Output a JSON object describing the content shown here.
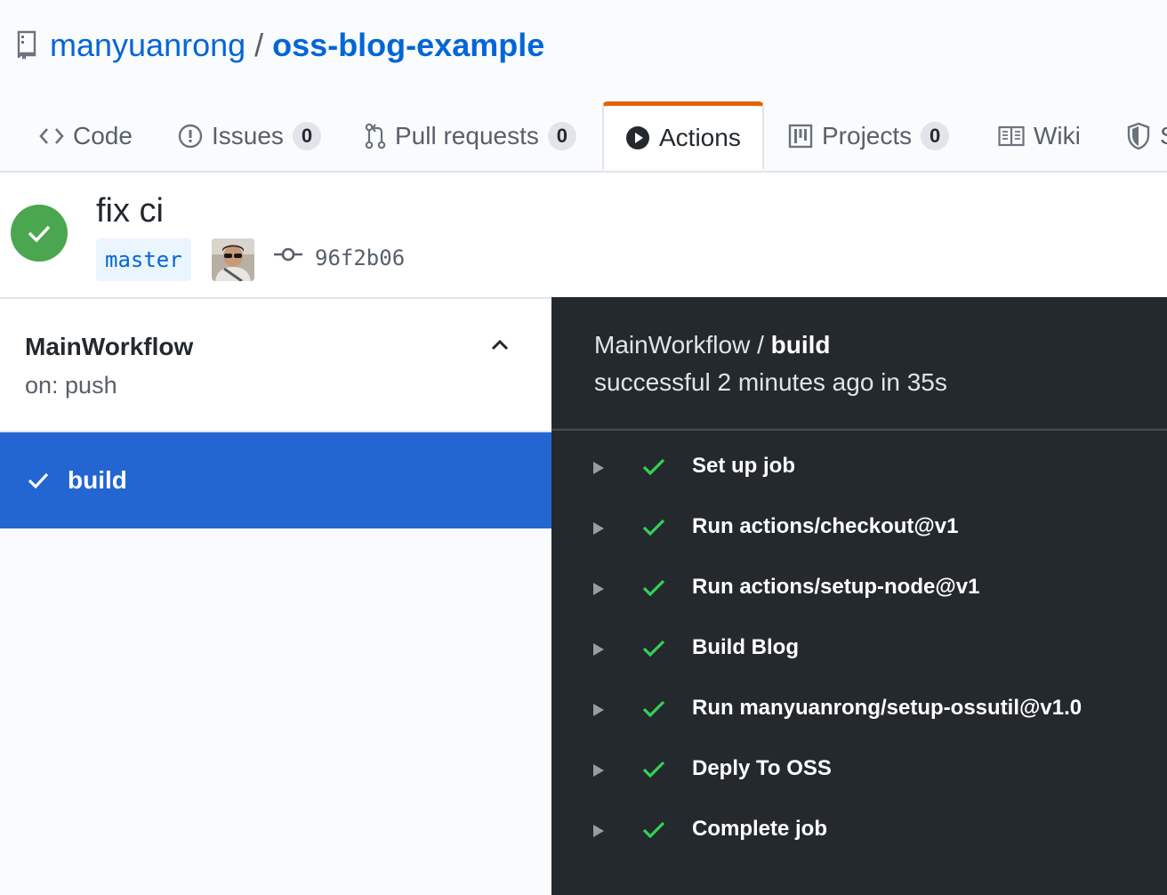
{
  "repo": {
    "owner": "manyuanrong",
    "separator": "/",
    "name": "oss-blog-example"
  },
  "tabs": [
    {
      "label": "Code",
      "icon": "code-icon"
    },
    {
      "label": "Issues",
      "count": "0",
      "icon": "issue-icon"
    },
    {
      "label": "Pull requests",
      "count": "0",
      "icon": "pull-request-icon"
    },
    {
      "label": "Actions",
      "icon": "play-icon",
      "selected": true
    },
    {
      "label": "Projects",
      "count": "0",
      "icon": "project-icon"
    },
    {
      "label": "Wiki",
      "icon": "book-icon"
    },
    {
      "label": "S",
      "icon": "shield-icon"
    }
  ],
  "run": {
    "title": "fix ci",
    "status": "success",
    "branch": "master",
    "commit_sha": "96f2b06"
  },
  "workflow": {
    "name": "MainWorkflow",
    "trigger": "on: push"
  },
  "jobs": [
    {
      "name": "build",
      "status": "success",
      "selected": true
    }
  ],
  "log": {
    "workflow_name": "MainWorkflow",
    "separator": " / ",
    "job_name": "build",
    "summary": "successful 2 minutes ago in 35s",
    "steps": [
      {
        "name": "Set up job"
      },
      {
        "name": "Run actions/checkout@v1"
      },
      {
        "name": "Run actions/setup-node@v1"
      },
      {
        "name": "Build Blog"
      },
      {
        "name": "Run manyuanrong/setup-ossutil@v1.0"
      },
      {
        "name": "Deply To OSS"
      },
      {
        "name": "Complete job"
      }
    ]
  },
  "colors": {
    "link": "#0366d6",
    "success": "#4aa64f",
    "selected_job_bg": "#2366d1",
    "log_bg": "#24292e",
    "active_tab_border": "#e36209"
  }
}
